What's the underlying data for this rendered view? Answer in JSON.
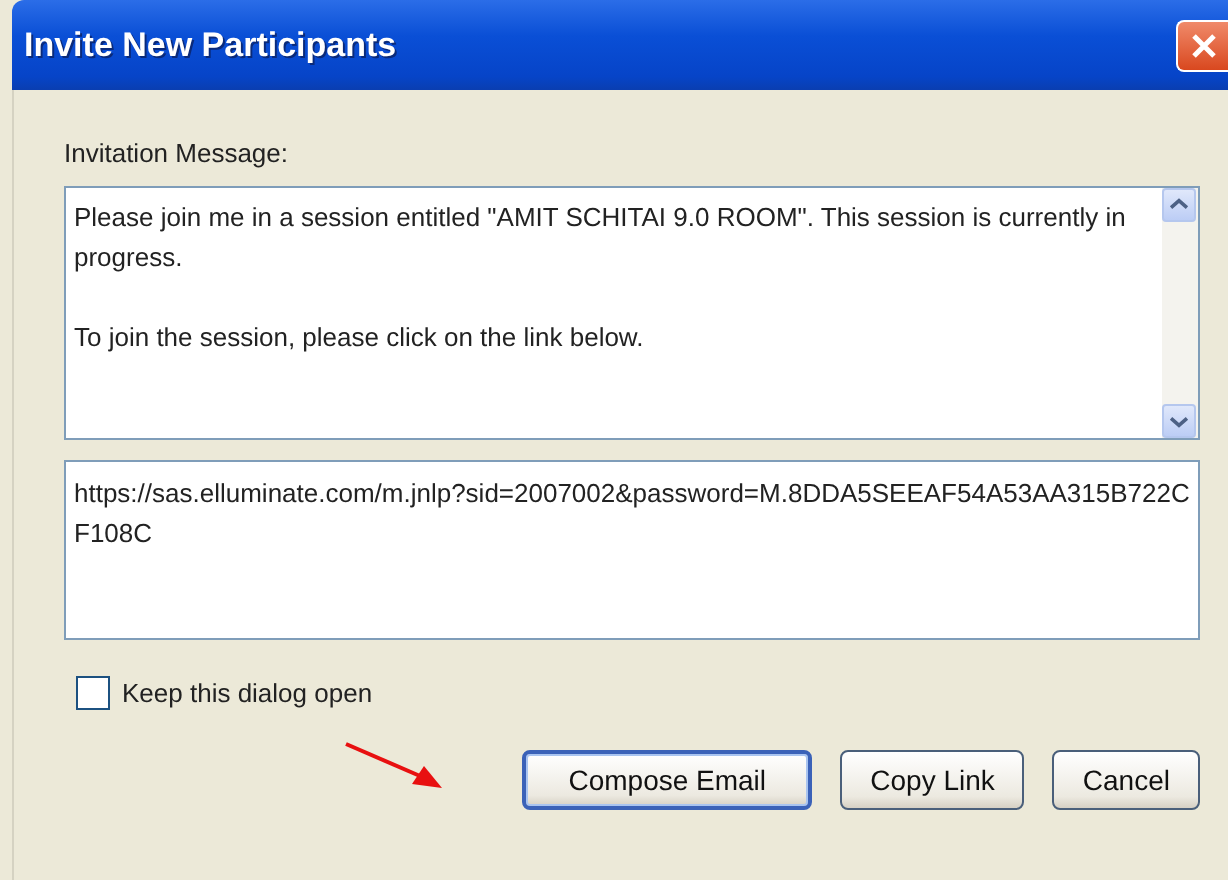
{
  "window": {
    "title": "Invite New Participants"
  },
  "message": {
    "label": "Invitation Message:",
    "paragraphs": [
      "Please join me in a session entitled \"AMIT SCHITAI 9.0 ROOM\". This session is currently in progress.",
      "To join the session, please click on the link below."
    ]
  },
  "link": {
    "value": "https://sas.elluminate.com/m.jnlp?sid=2007002&password=M.8DDA5SEEAF54A53AA315B722CF108C"
  },
  "keep_open": {
    "label": "Keep this dialog open",
    "checked": false
  },
  "buttons": [
    {
      "label": "Compose Email",
      "default": true
    },
    {
      "label": "Copy Link",
      "default": false
    },
    {
      "label": "Cancel",
      "default": false
    }
  ]
}
